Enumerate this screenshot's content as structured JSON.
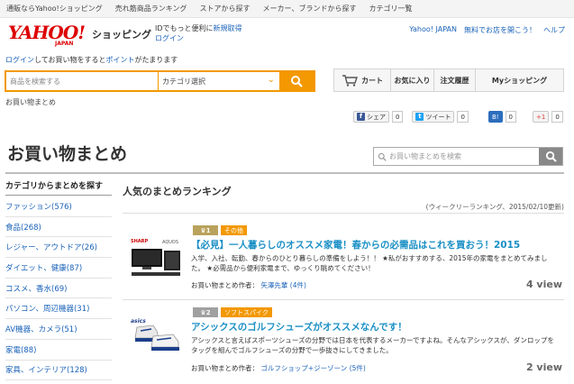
{
  "topnav": [
    "通販ならYahoo!ショッピング",
    "売れ筋商品ランキング",
    "ストアから探す",
    "メーカー、ブランドから探す",
    "カテゴリ一覧"
  ],
  "header": {
    "logo_text": "YAHOO!",
    "logo_sub": "JAPAN",
    "shopping": "ショッピング",
    "id_text": "IDでもっと便利に",
    "new_reg": "新規取得",
    "login": "ログイン",
    "right": {
      "yahoo": "Yahoo! JAPAN",
      "open": "無料でお店を開こう！",
      "help": "ヘルプ"
    }
  },
  "pointline": {
    "login": "ログイン",
    "mid": "してお買い物をすると",
    "point": "ポイント",
    "end": "がたまります"
  },
  "search": {
    "placeholder": "商品を検索する",
    "category": "カテゴリ選択"
  },
  "breadcrumb": "お買い物まとめ",
  "rnav": {
    "cart": "カート",
    "fav": "お気に入り",
    "history": "注文履歴",
    "my": "Myショッピング"
  },
  "social": {
    "share": "シェア",
    "share_count": "0",
    "tweet": "ツイート",
    "tweet_count": "0",
    "hatena": "B!",
    "hatena_count": "0",
    "gplus": "+1",
    "gplus_count": "0"
  },
  "page_title": "お買い物まとめ",
  "page_search_placeholder": "お買い物まとめを検索",
  "sidebar": {
    "heading": "カテゴリからまとめを探す",
    "items": [
      "ファッション(576)",
      "食品(268)",
      "レジャー、アウトドア(26)",
      "ダイエット、健康(87)",
      "コスメ、香水(69)",
      "パソコン、周辺機器(31)",
      "AV機器、カメラ(51)",
      "家電(88)",
      "家具、インテリア(128)"
    ]
  },
  "ranking": {
    "heading": "人気のまとめランキング",
    "period": "(ウィークリーランキング、2015/02/10更新)",
    "items": [
      {
        "rank": "1",
        "tag": "その他",
        "tag_color": "#f39800",
        "title": "【必見】一人暮らしのオススメ家電！春からの必需品はこれを買おう！2015",
        "desc": "入学、入社、転勤、春からのひとり暮らしの準備をしよう！！ ★私がおすすめする、2015年の家電をまとめてみました。 ★必需品から便利家電まで、ゆっくり眺めてください！",
        "author_label": "お買い物まとめ作者：",
        "author": "矢澤先輩",
        "count": "(4件)",
        "views": "4 view",
        "thumb_brand": "SHARP",
        "thumb_model": "AQUOS"
      },
      {
        "rank": "2",
        "tag": "ソフトスパイク",
        "tag_color": "#f39800",
        "title": "アシックスのゴルフシューズがオススメなんです！",
        "desc": "アシックスと言えばスポーツシューズの分野では日本を代表するメーカーですよね。そんなアシックスが、ダンロップをタッグを組んでゴルフシューズの分野で一歩抜きにしてきました。",
        "author_label": "お買い物まとめ作者：",
        "author": "ゴルフショップ+ジーゾーン",
        "count": "(5件)",
        "views": "2 view",
        "thumb_brand": "asics"
      }
    ]
  },
  "colors": {
    "accent": "#f39800",
    "link": "#1a62b8",
    "title_link": "#1a8fc5",
    "brand_red": "#dd0000"
  }
}
